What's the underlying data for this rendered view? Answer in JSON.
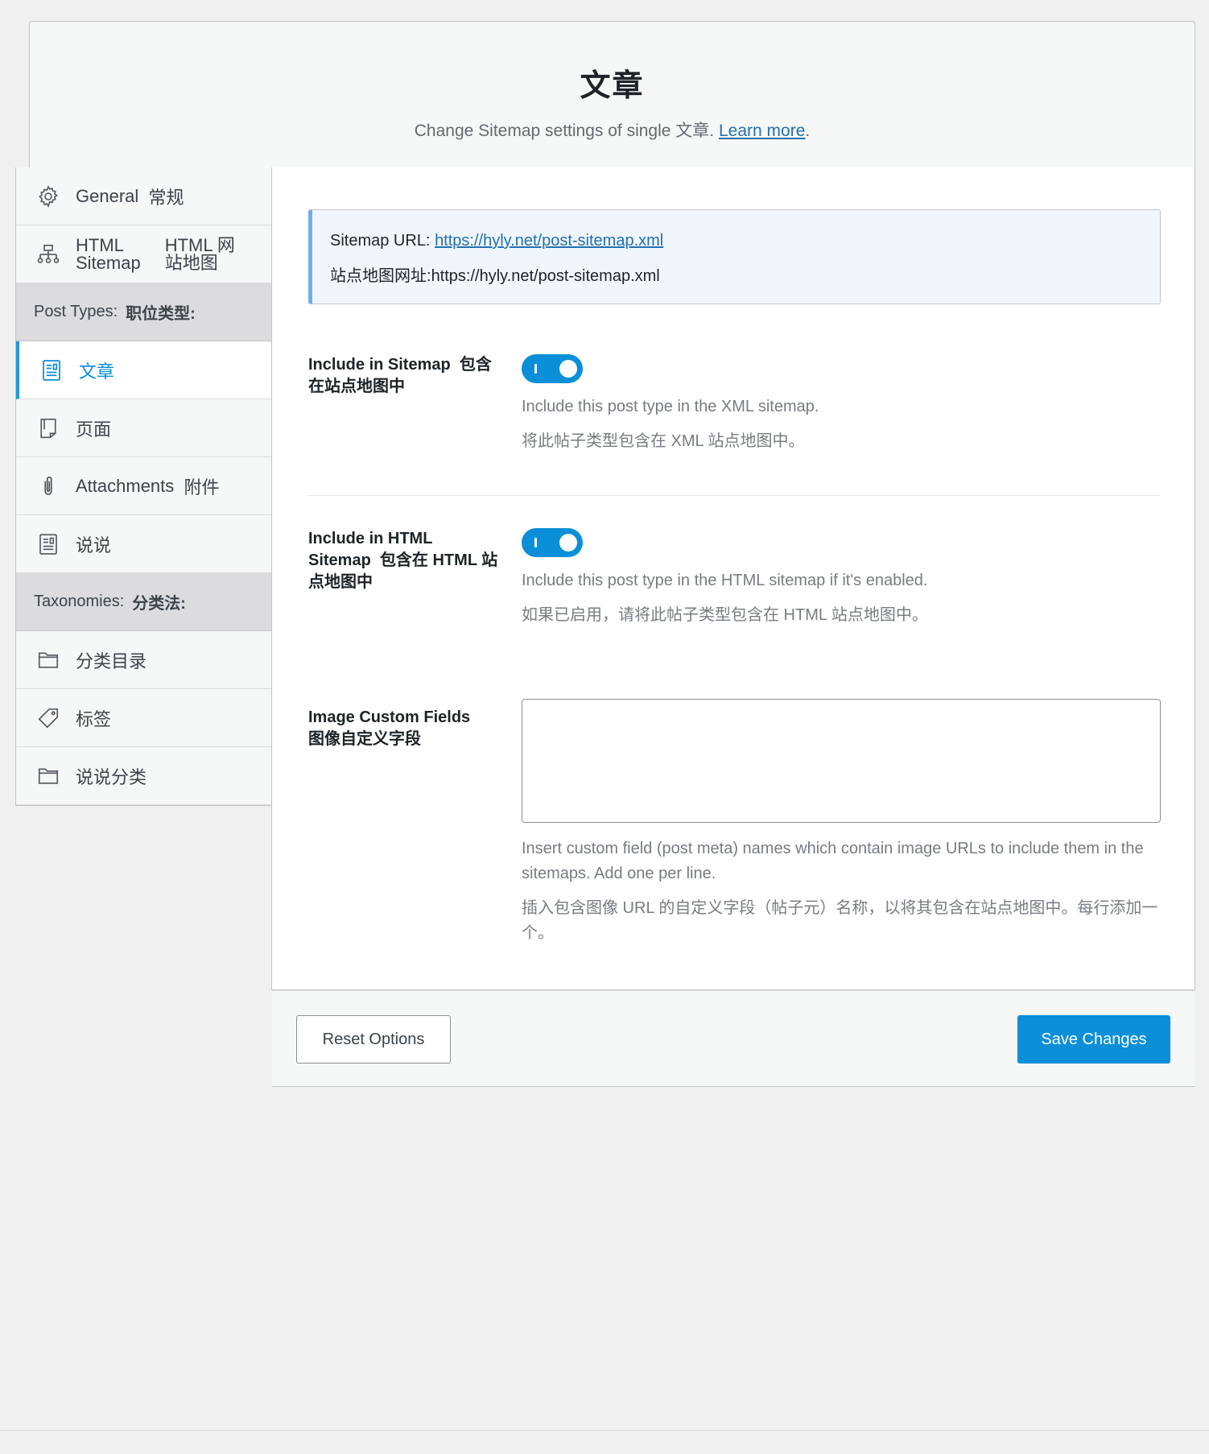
{
  "header": {
    "title": "文章",
    "subtitle": "Change Sitemap settings of single 文章.",
    "learn_more": "Learn more",
    "period": "."
  },
  "sidebar": {
    "items": [
      {
        "label": "General",
        "label_cn": "常规",
        "icon": "gear-icon"
      },
      {
        "label_line1": "HTML",
        "label_line2": "Sitemap",
        "label_cn_line1": "HTML 网",
        "label_cn_line2": "站地图",
        "icon": "sitemap-icon"
      }
    ],
    "post_types_group": {
      "label": "Post Types:",
      "label_cn": "职位类型:"
    },
    "post_types": [
      {
        "label": "文章",
        "icon": "document-icon",
        "active": true
      },
      {
        "label": "页面",
        "icon": "page-icon"
      },
      {
        "label": "Attachments",
        "label_cn": "附件",
        "icon": "paperclip-icon"
      },
      {
        "label": "说说",
        "icon": "note-icon"
      }
    ],
    "taxonomies_group": {
      "label": "Taxonomies:",
      "label_cn": "分类法:"
    },
    "taxonomies": [
      {
        "label": "分类目录",
        "icon": "folder-icon"
      },
      {
        "label": "标签",
        "icon": "tag-icon"
      },
      {
        "label": "说说分类",
        "icon": "folder-icon"
      }
    ]
  },
  "notice": {
    "url_label": "Sitemap URL:",
    "url": "https://hyly.net/post-sitemap.xml",
    "url_label_cn": "站点地图网址:",
    "url_cn": "https://hyly.net/post-sitemap.xml"
  },
  "settings": {
    "include_sitemap": {
      "label": "Include in Sitemap",
      "label_cn": "包含在站点地图中",
      "enabled": true,
      "desc": "Include this post type in the XML sitemap.",
      "desc_cn": "将此帖子类型包含在 XML 站点地图中。"
    },
    "include_html": {
      "label": "Include in HTML Sitemap",
      "label_cn": "包含在 HTML 站点地图中",
      "enabled": true,
      "desc": "Include this post type in the HTML sitemap if it's enabled.",
      "desc_cn": "如果已启用，请将此帖子类型包含在 HTML 站点地图中。"
    },
    "image_fields": {
      "label": "Image Custom Fields",
      "label_cn": "图像自定义字段",
      "value": "",
      "desc": "Insert custom field (post meta) names which contain image URLs to include them in the sitemaps. Add one per line.",
      "desc_cn": "插入包含图像 URL 的自定义字段（帖子元）名称，以将其包含在站点地图中。每行添加一个。"
    }
  },
  "footer": {
    "reset_label": "Reset Options",
    "save_label": "Save Changes"
  },
  "colors": {
    "accent": "#0a8fd8",
    "notice_bg": "#f0f6fc",
    "notice_border": "#72aee6"
  }
}
